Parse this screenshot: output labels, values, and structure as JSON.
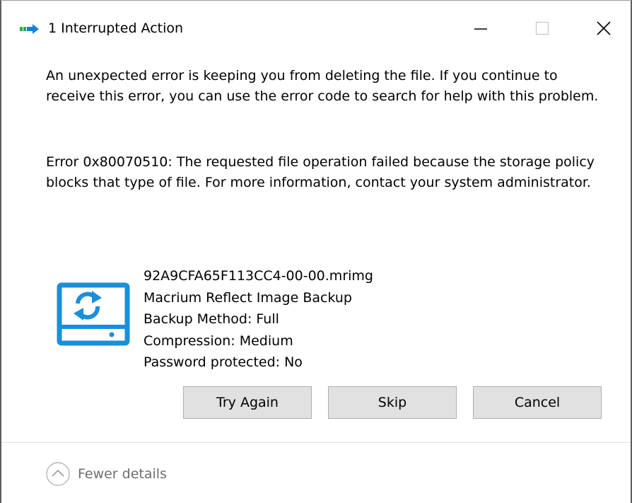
{
  "window": {
    "title": "1 Interrupted Action",
    "icon": "file-operation-icon",
    "controls": {
      "minimize": "minimize-icon",
      "maximize": "maximize-icon",
      "close": "close-icon"
    }
  },
  "dialog": {
    "message": "An unexpected error is keeping you from deleting the file. If you continue to receive this error, you can use the error code to search for help with this problem.",
    "error": "Error 0x80070510: The requested file operation failed because the storage policy blocks that type of file. For more information, contact your system administrator."
  },
  "file": {
    "icon": "backup-drive-icon",
    "name": "92A9CFA65F113CC4-00-00.mrimg",
    "type": "Macrium Reflect Image Backup",
    "backup_method": "Backup Method: Full",
    "compression": "Compression: Medium",
    "password": "Password protected: No"
  },
  "buttons": {
    "try_again": "Try Again",
    "skip": "Skip",
    "cancel": "Cancel"
  },
  "footer": {
    "details_label": "Fewer details",
    "details_icon": "chevron-up-icon"
  },
  "colors": {
    "accent": "#1a8fd8",
    "button_face": "#e1e1e1",
    "button_border": "#adadad",
    "muted_text": "#6d6d6d"
  }
}
